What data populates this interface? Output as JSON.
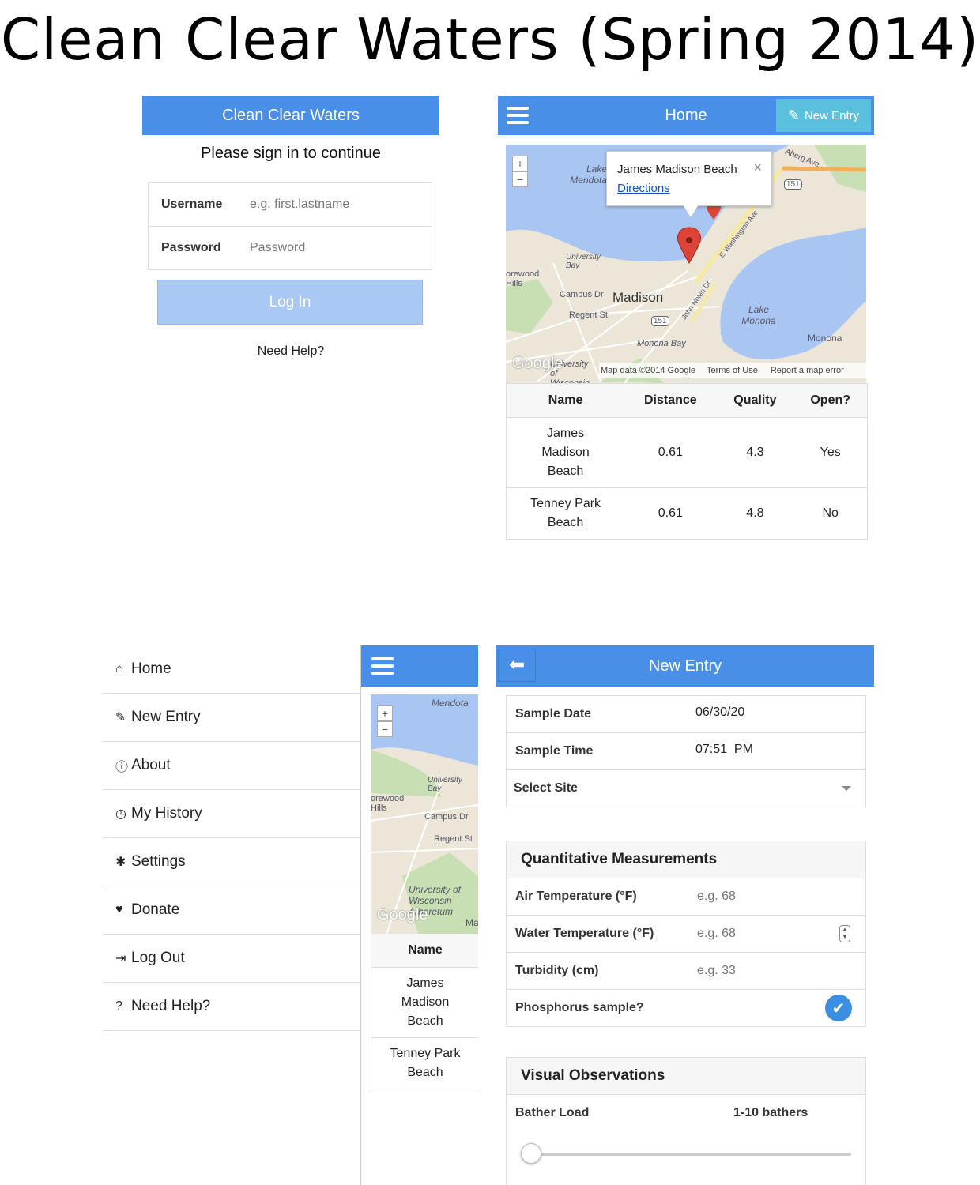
{
  "title": "Clean Clear Waters (Spring 2014)",
  "login": {
    "header": "Clean Clear Waters",
    "subtitle": "Please sign in to continue",
    "username_label": "Username",
    "username_placeholder": "e.g. first.lastname",
    "password_label": "Password",
    "password_placeholder": "Password",
    "login_button": "Log In",
    "help_link": "Need Help?"
  },
  "home": {
    "header": "Home",
    "new_entry_button": "New Entry",
    "map": {
      "popup_title": "James Madison Beach",
      "popup_link": "Directions",
      "labels": {
        "lake_mendota": "Lake Mendota",
        "university_bay": "University Bay",
        "shorewood_hills": "orewood Hills",
        "campus_dr": "Campus Dr",
        "madison": "Madison",
        "regent_st": "Regent St",
        "lake_monona": "Lake Monona",
        "monona": "Monona",
        "monona_bay": "Monona Bay",
        "john_nolen": "John Nolen Dr",
        "e_washington": "E Washington Ave",
        "aberg": "Aberg Ave",
        "hwy_151": "151",
        "university_wisconsin": "University of Wisconsin"
      },
      "google": "Google",
      "map_data": "Map data ©2014 Google",
      "terms": "Terms of Use",
      "report": "Report a map error"
    },
    "table": {
      "headers": [
        "Name",
        "Distance",
        "Quality",
        "Open?"
      ],
      "rows": [
        {
          "name_l1": "James",
          "name_l2": "Madison",
          "name_l3": "Beach",
          "distance": "0.61",
          "quality": "4.3",
          "open": "Yes"
        },
        {
          "name_l1": "Tenney Park",
          "name_l2": "Beach",
          "distance": "0.61",
          "quality": "4.8",
          "open": "No"
        }
      ]
    }
  },
  "menu": {
    "items": [
      {
        "icon": "home-icon",
        "label": "Home"
      },
      {
        "icon": "edit-icon",
        "label": "New Entry"
      },
      {
        "icon": "info-icon",
        "label": "About"
      },
      {
        "icon": "clock-icon",
        "label": "My History"
      },
      {
        "icon": "gear-icon",
        "label": "Settings"
      },
      {
        "icon": "heart-icon",
        "label": "Donate"
      },
      {
        "icon": "logout-icon",
        "label": "Log Out"
      },
      {
        "icon": "question-icon",
        "label": "Need Help?"
      }
    ],
    "side_map": {
      "mendota": "Mendota",
      "university_bay": "University Bay",
      "shorewood": "orewood Hills",
      "campus_dr": "Campus Dr",
      "regent_st": "Regent St",
      "uw": "University of Wisconsin Arboretum",
      "google": "Google",
      "ma": "Ma"
    },
    "side_table": {
      "header": "Name",
      "row1_l1": "James",
      "row1_l2": "Madison",
      "row1_l3": "Beach",
      "row2_l1": "Tenney Park",
      "row2_l2": "Beach"
    }
  },
  "new_entry": {
    "header": "New Entry",
    "sample_date_label": "Sample Date",
    "sample_date_value": "06/30/20",
    "sample_time_label": "Sample Time",
    "sample_time_value": "07:51  PM",
    "select_site": "Select Site",
    "quant_header": "Quantitative Measurements",
    "air_temp_label": "Air Temperature (°F)",
    "air_temp_placeholder": "e.g. 68",
    "water_temp_label": "Water Temperature (°F)",
    "water_temp_placeholder": "e.g. 68",
    "turbidity_label": "Turbidity (cm)",
    "turbidity_placeholder": "e.g. 33",
    "phosphorus_label": "Phosphorus sample?",
    "phosphorus_checked": true,
    "visual_header": "Visual Observations",
    "bather_load_label": "Bather Load",
    "bather_load_value": "1-10 bathers",
    "bather_load_slider": 0
  },
  "colors": {
    "accent": "#4a8fe7",
    "accent_light": "#5bc0de",
    "check": "#3a8fe3"
  }
}
